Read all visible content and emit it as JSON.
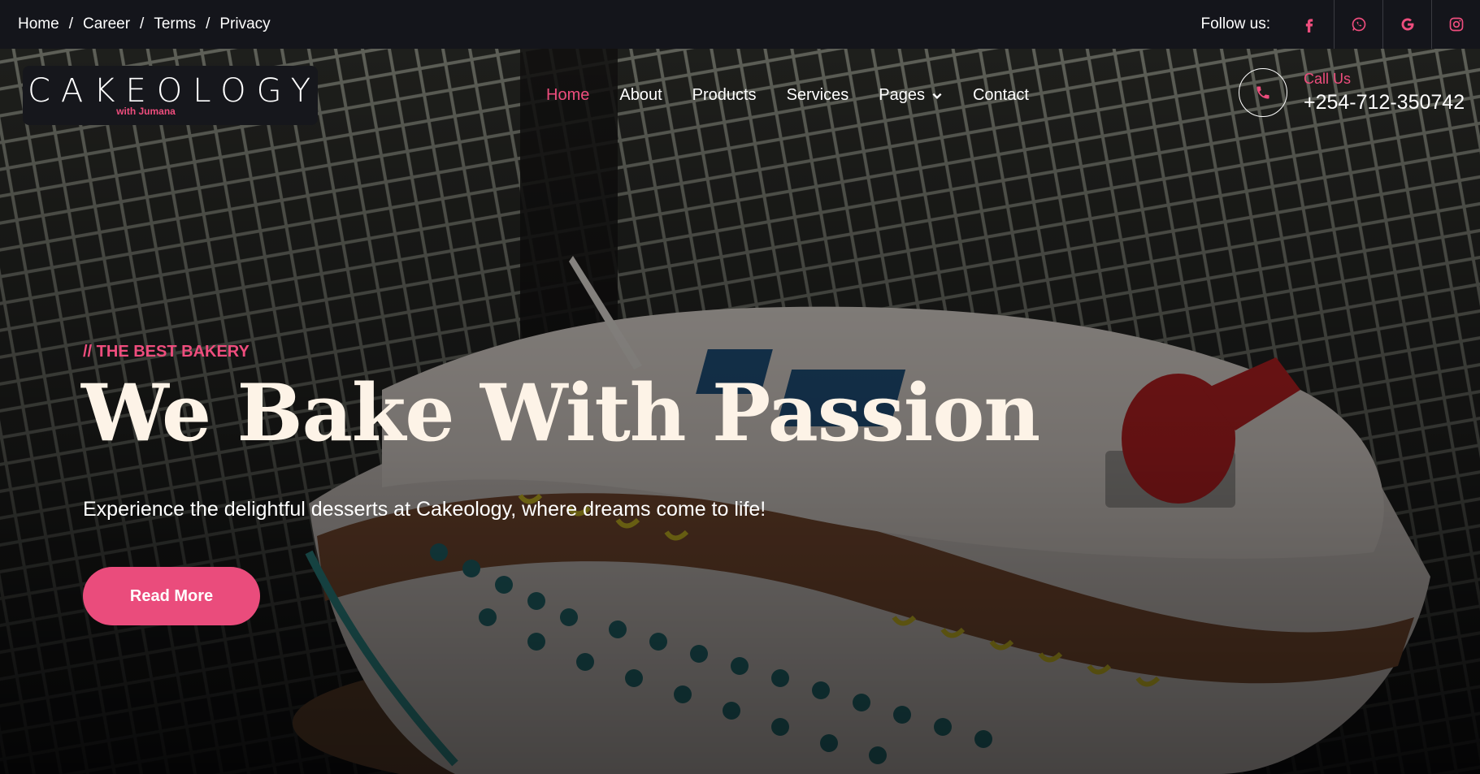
{
  "topbar": {
    "breadcrumbs": [
      "Home",
      "Career",
      "Terms",
      "Privacy"
    ],
    "separator": "/",
    "follow_label": "Follow us:",
    "social_icons": [
      "facebook-icon",
      "whatsapp-icon",
      "google-icon",
      "instagram-icon"
    ]
  },
  "header": {
    "logo": {
      "wordmark": "CAKEOLOGY",
      "tagline": "with Jumana"
    },
    "nav": [
      {
        "label": "Home",
        "active": true
      },
      {
        "label": "About"
      },
      {
        "label": "Products"
      },
      {
        "label": "Services"
      },
      {
        "label": "Pages",
        "dropdown": true
      },
      {
        "label": "Contact"
      }
    ],
    "call": {
      "label": "Call Us",
      "number": "+254-712-350742",
      "icon": "phone-icon"
    }
  },
  "hero": {
    "eyebrow": "// THE BEST BAKERY",
    "title": "We Bake With Passion",
    "subtitle": "Experience the delightful desserts at Cakeology, where dreams come to life!",
    "cta_label": "Read More"
  },
  "colors": {
    "accent": "#ea4c7c",
    "topbar_bg": "#14151b",
    "headline": "#fdf3e7"
  }
}
